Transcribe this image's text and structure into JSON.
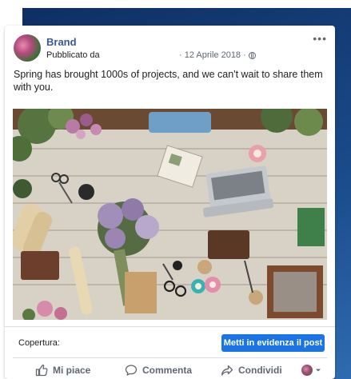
{
  "post": {
    "page_name": "Brand",
    "published_by": "Pubblicato da",
    "date_meta": "· 12 Aprile 2018 ·",
    "text": "Spring has brought 1000s of projects, and we can't wait to share them with you."
  },
  "footer": {
    "coverage_label": "Copertura:",
    "boost_label": "Metti in evidenza il post"
  },
  "actions": {
    "like": "Mi piace",
    "comment": "Commenta",
    "share": "Condividi"
  },
  "icons": [
    "more-options-icon",
    "globe-icon",
    "like-icon",
    "comment-icon",
    "share-icon",
    "page-avatar-icon",
    "chevron-down-icon"
  ],
  "colors": {
    "brand_link": "#385898",
    "boost_button": "#1b74e4",
    "background_panel": "#1b4c8c"
  }
}
